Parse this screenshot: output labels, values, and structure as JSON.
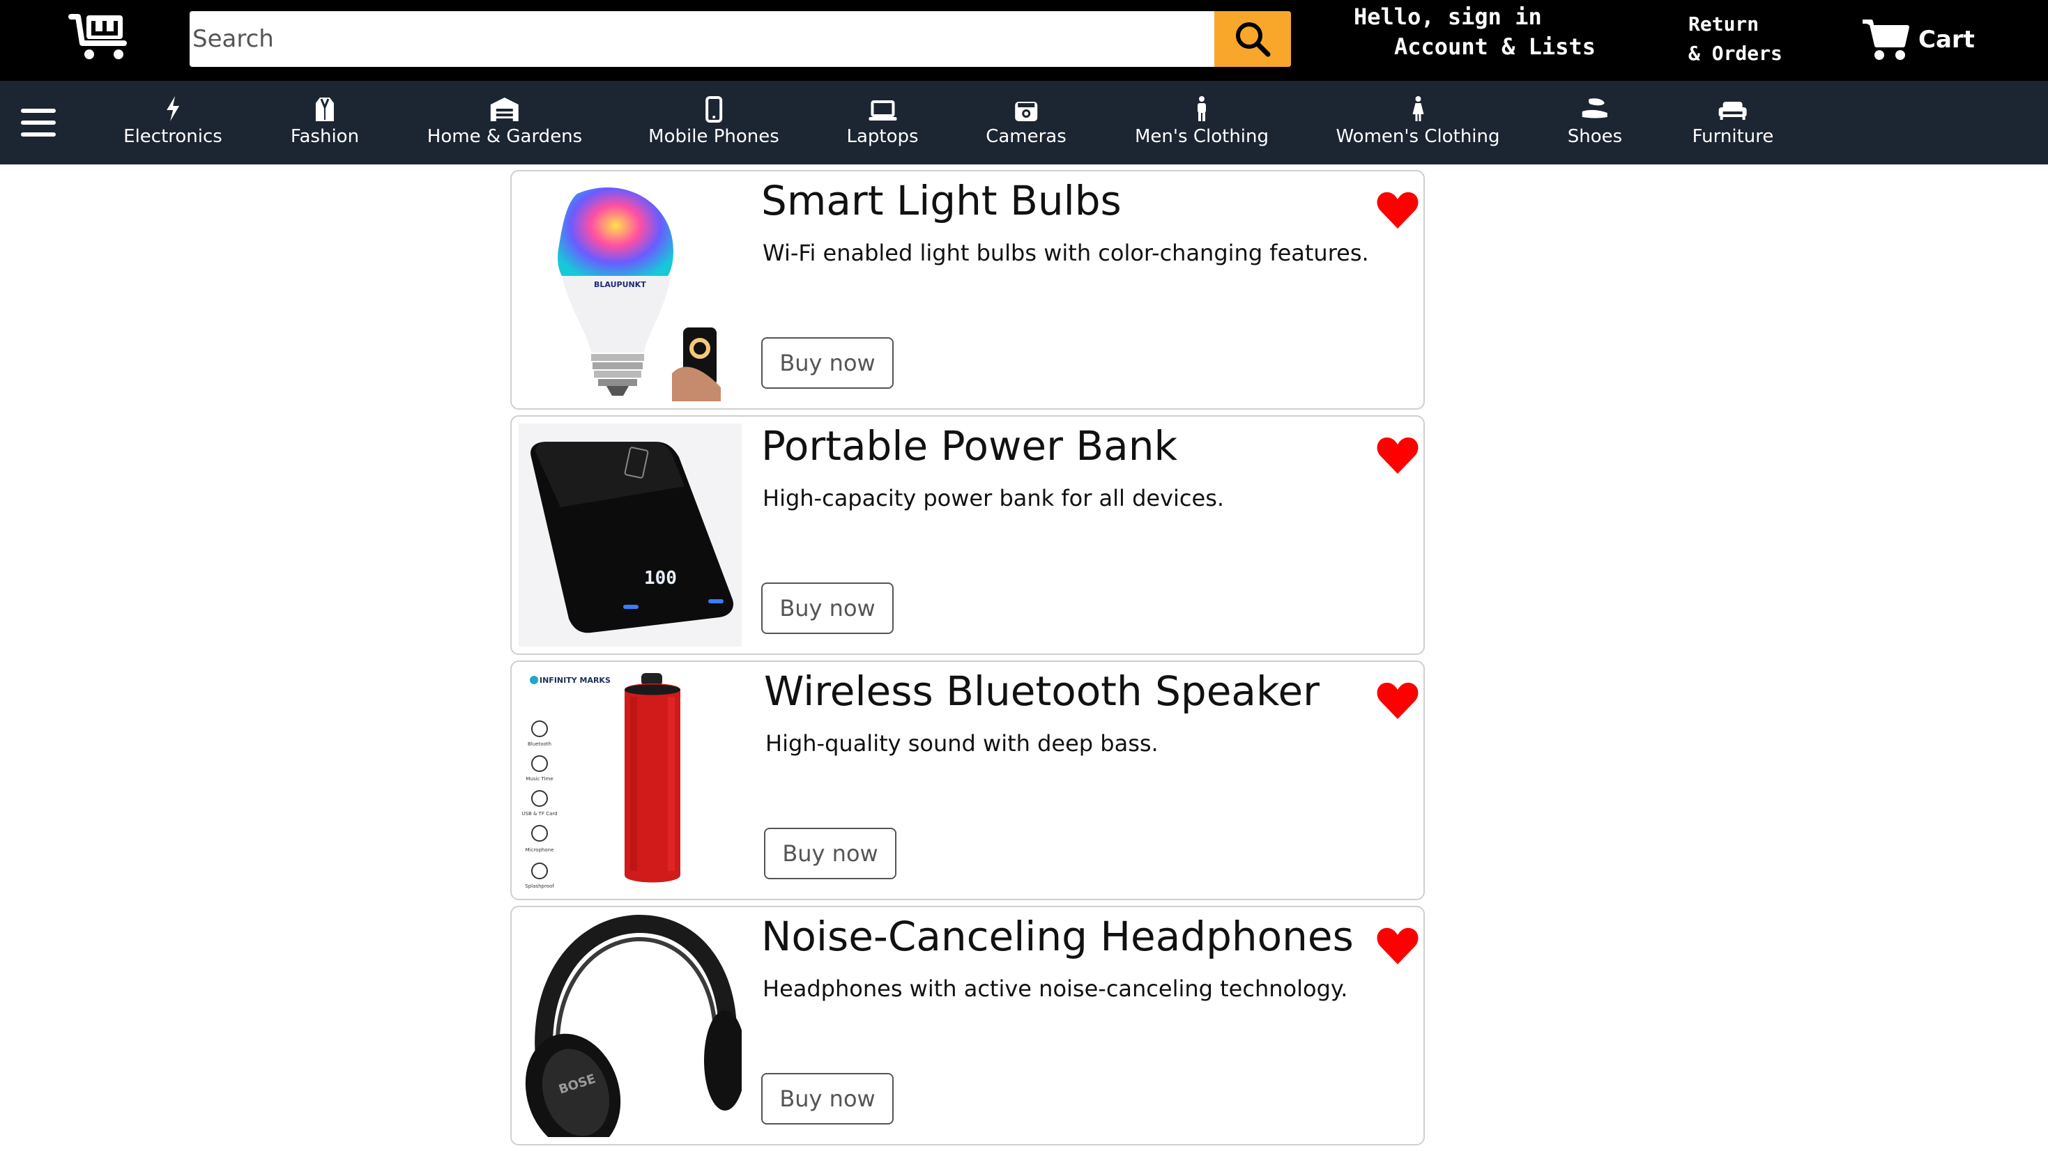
{
  "header": {
    "search_placeholder": "Search",
    "account_line1": "Hello, sign in",
    "account_line2": "Account & Lists",
    "orders_line1": "Return",
    "orders_line2": "& Orders",
    "cart_label": "Cart",
    "colors": {
      "background": "#000000",
      "search_button": "#f8a72b"
    }
  },
  "nav": {
    "background": "#1c2532",
    "categories": [
      {
        "label": "Electronics",
        "icon": "bolt-icon"
      },
      {
        "label": "Fashion",
        "icon": "suit-icon"
      },
      {
        "label": "Home & Gardens",
        "icon": "warehouse-icon"
      },
      {
        "label": "Mobile Phones",
        "icon": "mobile-icon"
      },
      {
        "label": "Laptops",
        "icon": "laptop-icon"
      },
      {
        "label": "Cameras",
        "icon": "camera-icon"
      },
      {
        "label": "Men's Clothing",
        "icon": "male-icon"
      },
      {
        "label": "Women's Clothing",
        "icon": "female-icon"
      },
      {
        "label": "Shoes",
        "icon": "shoe-icon"
      },
      {
        "label": "Furniture",
        "icon": "couch-icon"
      }
    ]
  },
  "products": [
    {
      "title": "Smart Light Bulbs",
      "description": "Wi-Fi enabled light bulbs with color-changing features.",
      "button": "Buy now",
      "image": "smart-bulb-image",
      "brand_text": "BLAUPUNKT"
    },
    {
      "title": "Portable Power Bank",
      "description": "High-capacity power bank for all devices.",
      "button": "Buy now",
      "image": "power-bank-image",
      "display_text": "100"
    },
    {
      "title": "Wireless Bluetooth Speaker",
      "description": "High-quality sound with deep bass.",
      "button": "Buy now",
      "image": "bluetooth-speaker-image",
      "brand_text": "INFINITY MARKS",
      "features": [
        "Bluetooth",
        "Music Time",
        "USB & TF Card",
        "Microphone",
        "Splashproof"
      ]
    },
    {
      "title": "Noise-Canceling Headphones",
      "description": "Headphones with active noise-canceling technology.",
      "button": "Buy now",
      "image": "headphones-image",
      "brand_text": "BOSE"
    }
  ],
  "accent": {
    "heart": "#ff0000"
  }
}
